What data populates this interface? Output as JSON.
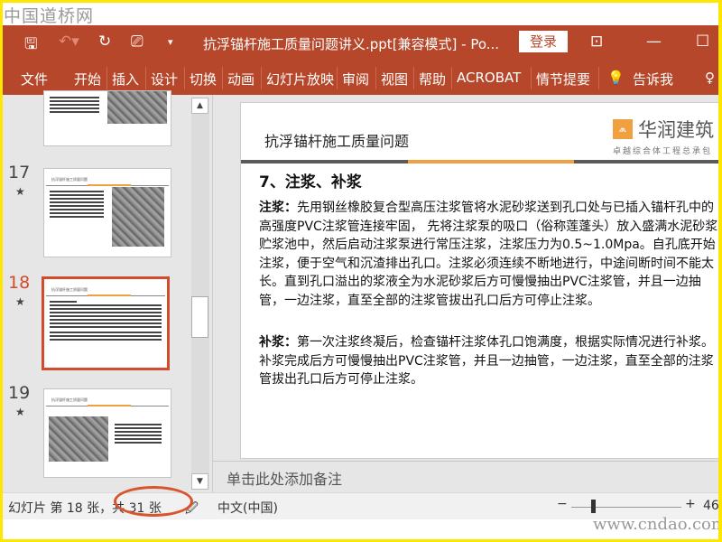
{
  "watermark_top": "中国道桥网",
  "watermark_bottom": "www.cndao.com",
  "titlebar": {
    "title": "抗浮锚杆施工质量问题讲义.ppt[兼容模式]  -  Po...",
    "login": "登录",
    "icons": [
      "save-icon",
      "undo-icon",
      "redo-icon",
      "present-icon",
      "customize-icon",
      "ribbon-display-icon",
      "minimize-icon",
      "maximize-icon"
    ]
  },
  "ribbon": {
    "tabs": [
      "文件",
      "开始",
      "插入",
      "设计",
      "切换",
      "动画",
      "幻灯片放映",
      "审阅",
      "视图",
      "帮助",
      "ACROBAT",
      "情节提要"
    ],
    "tell_me": "告诉我"
  },
  "thumbnails": [
    {
      "number": "17",
      "title": "抗浮锚杆施工质量问题"
    },
    {
      "number": "18",
      "title": "抗浮锚杆施工质量问题",
      "selected": true
    },
    {
      "number": "19",
      "title": "抗浮锚杆施工质量问题"
    }
  ],
  "slide": {
    "title": "抗浮锚杆施工质量问题",
    "logo_name": "华润建筑",
    "logo_tagline": "卓越综合体工程总承包",
    "heading": "7、注浆、补浆",
    "p1_label": "注浆：",
    "p1_text": "先用钢丝橡胶复合型高压注浆管将水泥砂浆送到孔口处与已插入锚杆孔中的高强度PVC注浆管连接牢固， 先将注浆泵的吸口（俗称莲蓬头）放入盛满水泥砂浆贮浆池中，然后启动注浆泵进行常压注浆，注浆压力为0.5~1.0Mpa。自孔底开始注浆，便于空气和沉渣排出孔口。注浆必须连续不断地进行，中途间断时间不能太长。直到孔口溢出的浆液全为水泥砂浆后方可慢慢抽出PVC注浆管，并且一边抽管，一边注浆，直至全部的注浆管拔出孔口后方可停止注浆。",
    "p2_label": "补浆：",
    "p2_text": "第一次注浆终凝后，检查锚杆注浆体孔口饱满度，根据实际情况进行补浆。 补浆完成后方可慢慢抽出PVC注浆管，并且一边抽管，一边注浆，直至全部的注浆管拔出孔口后方可停止注浆。"
  },
  "notes_placeholder": "单击此处添加备注",
  "status": {
    "slide_info": "幻灯片 第 18 张，共 31 张",
    "language": "中文(中国)",
    "zoom": "46"
  },
  "colors": {
    "accent": "#b7472a",
    "highlight": "#d24b2d",
    "logo_orange": "#f0a040"
  }
}
